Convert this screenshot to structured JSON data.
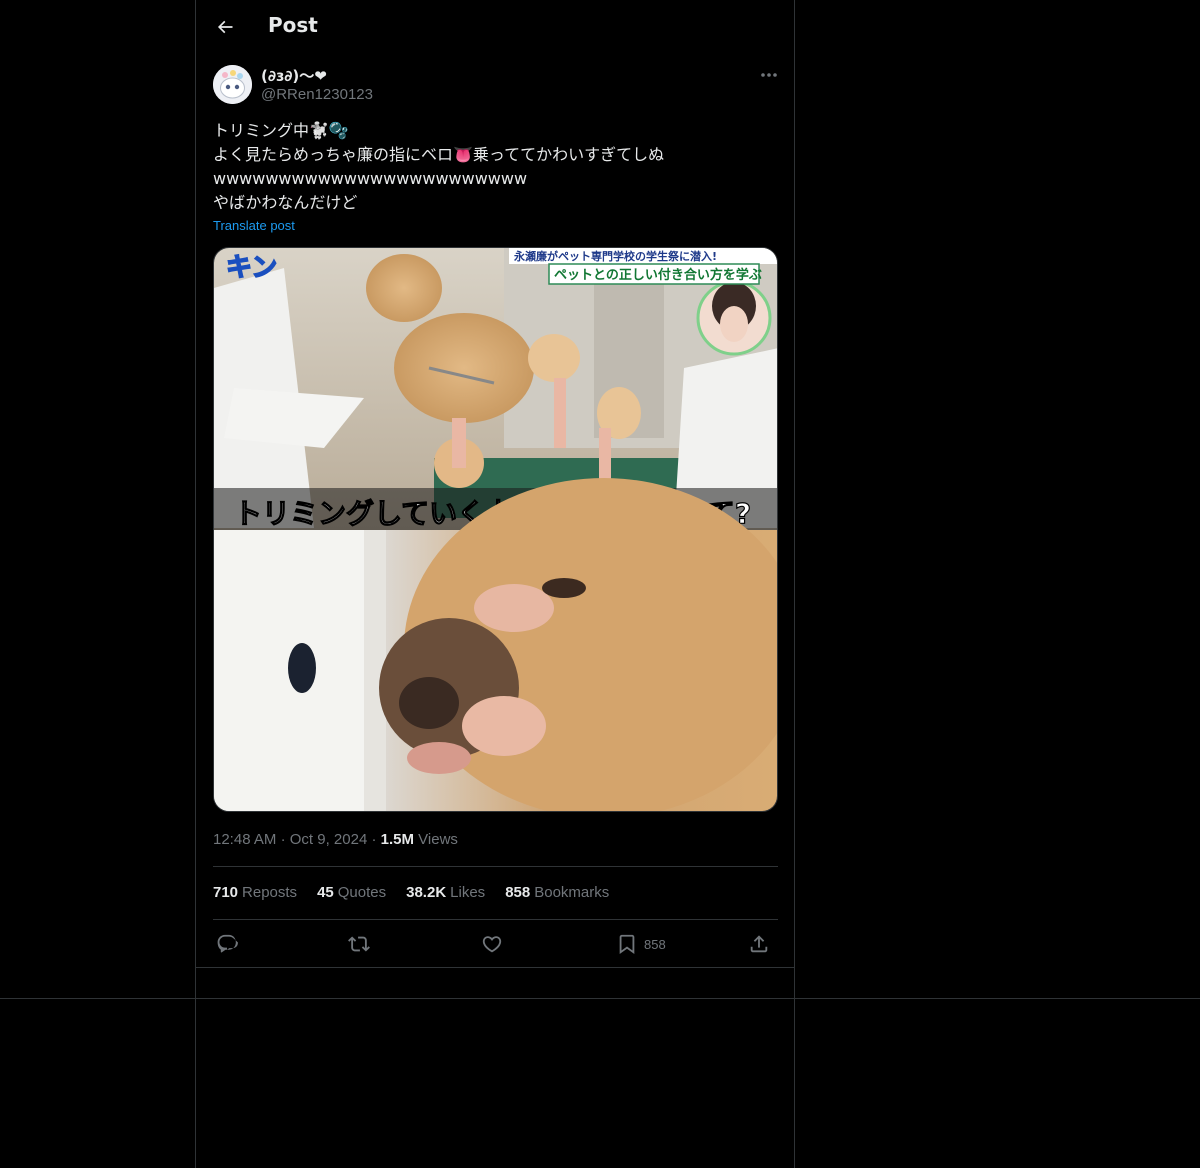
{
  "header": {
    "title": "Post",
    "back_icon": "arrow-left-icon"
  },
  "post": {
    "author": {
      "display_name": "(∂ɜ∂)〜❤",
      "handle": "@RRen1230123"
    },
    "text_lines": [
      "トリミング中🐩🫧",
      "よく見たらめっちゃ廉の指にベロ👅乗っててかわいすぎてしぬ",
      "wwwwwwwwwwwwwwwwwwwwwwww",
      "やばかわなんだけど"
    ],
    "translate_label": "Translate post",
    "media": {
      "caption_top_line1": "永瀬廉がペット専門学校の学生祭に潜入!",
      "caption_top_line2": "ペットとの正しい付き合い方を学ぶ",
      "caption_bottom": "トリミングしていく上で大変なことって?",
      "show_logo": "キン"
    },
    "time": "12:48 AM",
    "date": "Oct 9, 2024",
    "views_count": "1.5M",
    "views_label": "Views",
    "stats": {
      "reposts_count": "710",
      "reposts_label": "Reposts",
      "quotes_count": "45",
      "quotes_label": "Quotes",
      "likes_count": "38.2K",
      "likes_label": "Likes",
      "bookmarks_count": "858",
      "bookmarks_label": "Bookmarks"
    },
    "actions": {
      "bookmark_count": "858"
    }
  },
  "colors": {
    "background": "#000000",
    "text": "#e7e9ea",
    "secondary": "#71767b",
    "link": "#1d9bf0",
    "border": "#2f3336"
  }
}
